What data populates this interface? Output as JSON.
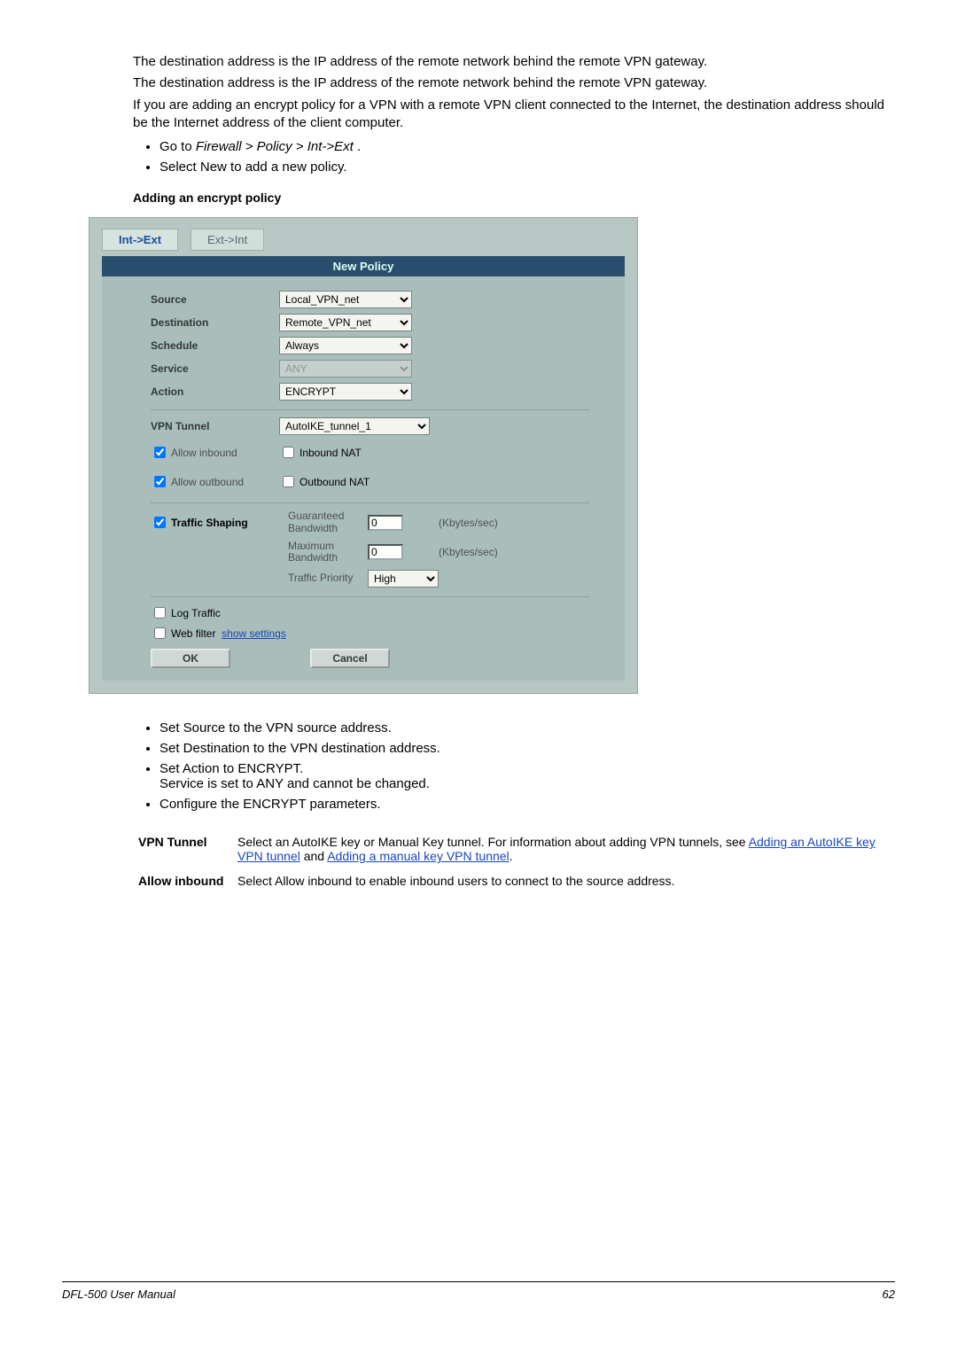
{
  "intro": {
    "p1": "The destination address is the IP address of the remote network behind the remote VPN gateway.",
    "p2": "The destination address is the IP address of the remote network behind the remote VPN gateway.",
    "p3": "If you are adding an encrypt policy for a VPN with a remote VPN client connected to the Internet, the destination address should be the Internet address of the client computer."
  },
  "pre_bullets": {
    "b1_pre": "Go to ",
    "b1_path": "Firewall > Policy > Int->Ext",
    "b1_post": " .",
    "b2": "Select New to add a new policy."
  },
  "caption": "Adding an encrypt policy",
  "shot": {
    "tab_active": "Int->Ext",
    "tab_other": "Ext->Int",
    "header": "New Policy",
    "labels": {
      "source": "Source",
      "destination": "Destination",
      "schedule": "Schedule",
      "service": "Service",
      "action": "Action",
      "vpn_tunnel": "VPN Tunnel",
      "allow_in": "Allow inbound",
      "inbound_nat": "Inbound NAT",
      "allow_out": "Allow outbound",
      "outbound_nat": "Outbound NAT",
      "traffic_shaping": "Traffic Shaping",
      "guaranteed": "Guaranteed Bandwidth",
      "maximum": "Maximum Bandwidth",
      "priority": "Traffic Priority",
      "kbytes": "(Kbytes/sec)",
      "log": "Log Traffic",
      "webfilter": "Web filter",
      "show_settings": "show settings",
      "ok": "OK",
      "cancel": "Cancel"
    },
    "values": {
      "source": "Local_VPN_net",
      "destination": "Remote_VPN_net",
      "schedule": "Always",
      "service": "ANY",
      "action": "ENCRYPT",
      "vpn_tunnel": "AutoIKE_tunnel_1",
      "guaranteed": "0",
      "maximum": "0",
      "priority": "High"
    },
    "checks": {
      "allow_in": true,
      "inbound_nat": false,
      "allow_out": true,
      "outbound_nat": false,
      "traffic_shaping": true,
      "log": false,
      "webfilter": false
    }
  },
  "post_bullets": {
    "b1": "Set Source to the VPN source address.",
    "b2": "Set Destination to the VPN destination address.",
    "b3a": "Set Action to ENCRYPT.",
    "b3b": "Service is set to ANY and cannot be changed.",
    "b4": "Configure the ENCRYPT parameters."
  },
  "defs": {
    "vpn_tunnel_term": "VPN Tunnel",
    "vpn_tunnel_text_a": "Select an AutoIKE key or Manual Key tunnel. For information about adding VPN tunnels, see ",
    "vpn_tunnel_link1": "Adding an AutoIKE key VPN tunnel",
    "vpn_tunnel_mid": " and ",
    "vpn_tunnel_link2": "Adding a manual key VPN tunnel",
    "vpn_tunnel_text_b": ".",
    "allow_in_term": "Allow inbound",
    "allow_in_text": "Select Allow inbound to enable inbound users to connect to the source address."
  },
  "footer": {
    "left": "DFL-500 User Manual",
    "right": "62"
  }
}
